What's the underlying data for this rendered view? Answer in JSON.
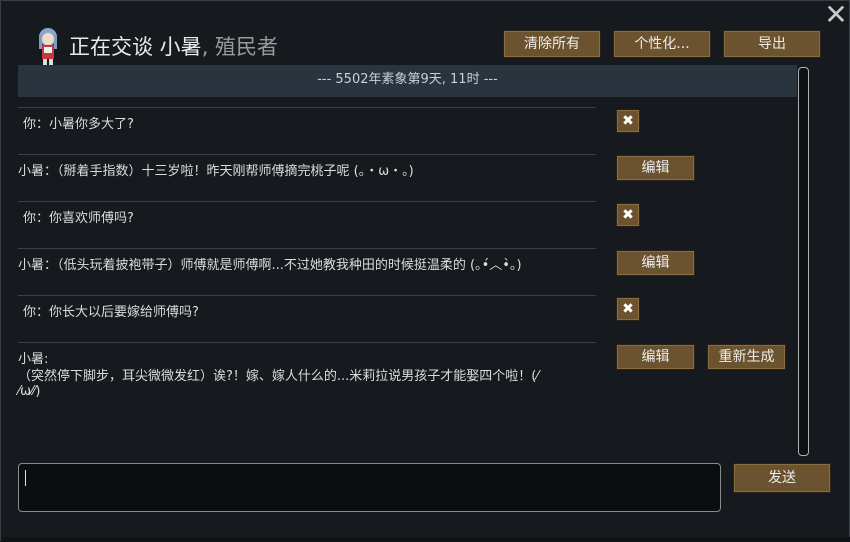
{
  "header": {
    "title_prefix": "正在交谈 小暑",
    "title_suffix": ", 殖民者",
    "clear_all_label": "清除所有",
    "personalize_label": "个性化...",
    "export_label": "导出"
  },
  "date_bar": "--- 5502年素象第9天, 11时 ---",
  "messages": [
    {
      "text": "你：小暑你多大了?"
    },
    {
      "text": "小暑：（掰着手指数）十三岁啦！昨天刚帮师傅摘完桃子呢 (。・ω・。)",
      "edit_label": "编辑"
    },
    {
      "text": "你：你喜欢师傅吗?"
    },
    {
      "text": "小暑：（低头玩着披袍带子）师傅就是师傅啊...不过她教我种田的时候挺温柔的 (｡•́︿•̀｡)",
      "edit_label": "编辑"
    },
    {
      "text": "你：你长大以后要嫁给师傅吗?"
    },
    {
      "speaker": "小暑:",
      "line1": "（突然停下脚步，耳尖微微发红）诶?！嫁、嫁人什么的...米莉拉说男孩子才能娶四个啦！(⁄",
      "line2": "⁄ω⁄⁄)",
      "edit_label": "编辑",
      "regenerate_label": "重新生成"
    }
  ],
  "input": {
    "value": ""
  },
  "send_label": "发送",
  "colors": {
    "button": "#6b5330",
    "background": "#16191d",
    "date_bar": "#2a343f"
  }
}
